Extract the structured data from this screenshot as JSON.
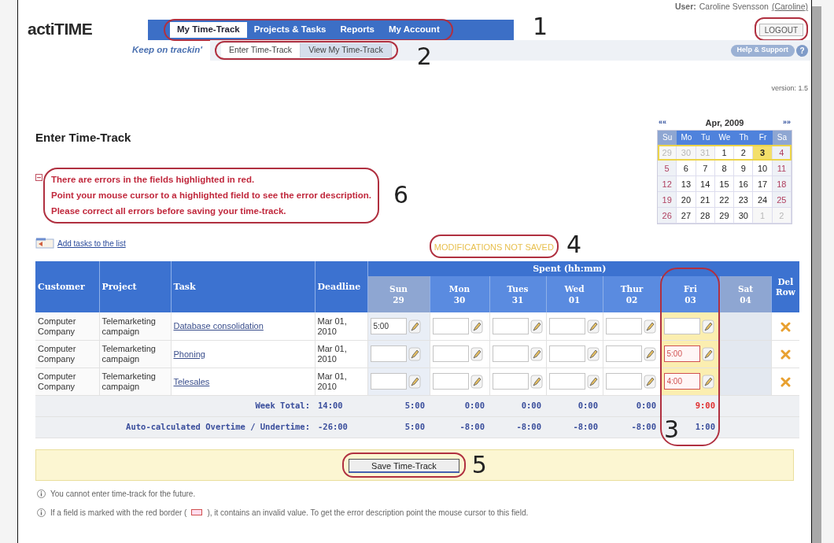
{
  "logo": {
    "name": "actiTIME",
    "slogan": "Keep on trackin'"
  },
  "main_tabs": {
    "callout": "1",
    "items": [
      {
        "label": "My Time-Track",
        "selected": true
      },
      {
        "label": "Projects & Tasks",
        "selected": false
      },
      {
        "label": "Reports",
        "selected": false
      },
      {
        "label": "My Account",
        "selected": false
      }
    ]
  },
  "user": {
    "label": "User:",
    "name": "Caroline Svensson",
    "login": "(Caroline)"
  },
  "logout": {
    "label": "LOGOUT"
  },
  "sub_tabs": {
    "callout": "2",
    "items": [
      {
        "label": "Enter Time-Track",
        "selected": true
      },
      {
        "label": "View My Time-Track",
        "selected": false
      }
    ]
  },
  "help": {
    "label": "Help & Support",
    "icon_text": "?"
  },
  "version": "version: 1.5",
  "title": "Enter Time-Track",
  "errors": {
    "callout": "6",
    "lines": [
      "There are errors in the fields highlighted in red.",
      "Point your mouse cursor to a highlighted field to see the error description.",
      "Please correct all errors before saving your time-track."
    ]
  },
  "add_tasks": "Add tasks to the list",
  "status": {
    "callout": "4",
    "text": "MODIFICATIONS NOT SAVED"
  },
  "calendar": {
    "prev": "««",
    "next": "»»",
    "month": "Apr, 2009",
    "weekdays": [
      "Su",
      "Mo",
      "Tu",
      "We",
      "Th",
      "Fr",
      "Sa"
    ],
    "weeks": [
      {
        "selected": true,
        "days": [
          {
            "d": "29",
            "kind": "other"
          },
          {
            "d": "30",
            "kind": "other"
          },
          {
            "d": "31",
            "kind": "other"
          },
          {
            "d": "1",
            "kind": "day"
          },
          {
            "d": "2",
            "kind": "day"
          },
          {
            "d": "3",
            "kind": "today"
          },
          {
            "d": "4",
            "kind": "weekend"
          }
        ]
      },
      {
        "selected": false,
        "days": [
          {
            "d": "5",
            "kind": "weekend"
          },
          {
            "d": "6",
            "kind": "day"
          },
          {
            "d": "7",
            "kind": "day"
          },
          {
            "d": "8",
            "kind": "day"
          },
          {
            "d": "9",
            "kind": "day"
          },
          {
            "d": "10",
            "kind": "day"
          },
          {
            "d": "11",
            "kind": "weekend"
          }
        ]
      },
      {
        "selected": false,
        "days": [
          {
            "d": "12",
            "kind": "weekend"
          },
          {
            "d": "13",
            "kind": "day"
          },
          {
            "d": "14",
            "kind": "day"
          },
          {
            "d": "15",
            "kind": "day"
          },
          {
            "d": "16",
            "kind": "day"
          },
          {
            "d": "17",
            "kind": "day"
          },
          {
            "d": "18",
            "kind": "weekend"
          }
        ]
      },
      {
        "selected": false,
        "days": [
          {
            "d": "19",
            "kind": "weekend"
          },
          {
            "d": "20",
            "kind": "day"
          },
          {
            "d": "21",
            "kind": "day"
          },
          {
            "d": "22",
            "kind": "day"
          },
          {
            "d": "23",
            "kind": "day"
          },
          {
            "d": "24",
            "kind": "day"
          },
          {
            "d": "25",
            "kind": "weekend"
          }
        ]
      },
      {
        "selected": false,
        "days": [
          {
            "d": "26",
            "kind": "weekend"
          },
          {
            "d": "27",
            "kind": "day"
          },
          {
            "d": "28",
            "kind": "day"
          },
          {
            "d": "29",
            "kind": "day"
          },
          {
            "d": "30",
            "kind": "day"
          },
          {
            "d": "1",
            "kind": "other"
          },
          {
            "d": "2",
            "kind": "other"
          }
        ]
      }
    ]
  },
  "table": {
    "columns": [
      "Customer",
      "Project",
      "Task",
      "Deadline"
    ],
    "spent_label": "Spent (hh:mm)",
    "del_label": "Del Row",
    "callout": "3",
    "days": [
      {
        "name": "Sun",
        "date": "29",
        "kind": "weekend"
      },
      {
        "name": "Mon",
        "date": "30",
        "kind": "workday"
      },
      {
        "name": "Tues",
        "date": "31",
        "kind": "workday"
      },
      {
        "name": "Wed",
        "date": "01",
        "kind": "workday"
      },
      {
        "name": "Thur",
        "date": "02",
        "kind": "workday"
      },
      {
        "name": "Fri",
        "date": "03",
        "kind": "today"
      },
      {
        "name": "Sat",
        "date": "04",
        "kind": "future"
      }
    ],
    "rows": [
      {
        "customer": "Computer Company",
        "project": "Telemarketing campaign",
        "task": "Database consolidation",
        "deadline": "Mar 01, 2010",
        "cells": [
          {
            "value": "5:00",
            "error": false
          },
          {
            "error": false
          },
          {
            "error": false
          },
          {
            "error": false
          },
          {
            "error": false
          },
          {
            "error": false
          }
        ]
      },
      {
        "customer": "Computer Company",
        "project": "Telemarketing campaign",
        "task": "Phoning",
        "deadline": "Mar 01, 2010",
        "cells": [
          {
            "error": false
          },
          {
            "error": false
          },
          {
            "error": false
          },
          {
            "error": false
          },
          {
            "error": false
          },
          {
            "value": "5:00",
            "error": true
          }
        ]
      },
      {
        "customer": "Computer Company",
        "project": "Telemarketing campaign",
        "task": "Telesales",
        "deadline": "Mar 01, 2010",
        "cells": [
          {
            "error": false
          },
          {
            "error": false
          },
          {
            "error": false
          },
          {
            "error": false
          },
          {
            "error": false
          },
          {
            "value": "4:00",
            "error": true
          }
        ]
      }
    ],
    "totals": [
      {
        "label": "Week Total:",
        "total": "14:00",
        "values": [
          {
            "v": "5:00",
            "color": "#3a4e9c"
          },
          {
            "v": "0:00",
            "color": "#3a4e9c"
          },
          {
            "v": "0:00",
            "color": "#3a4e9c"
          },
          {
            "v": "0:00",
            "color": "#3a4e9c"
          },
          {
            "v": "0:00",
            "color": "#3a4e9c"
          },
          {
            "v": "9:00",
            "color": "#e03030"
          }
        ]
      },
      {
        "label": "Auto-calculated Overtime / Undertime:",
        "total": "-26:00",
        "values": [
          {
            "v": "5:00",
            "color": "#3a4e9c"
          },
          {
            "v": "-8:00",
            "color": "#3a4e9c"
          },
          {
            "v": "-8:00",
            "color": "#3a4e9c"
          },
          {
            "v": "-8:00",
            "color": "#3a4e9c"
          },
          {
            "v": "-8:00",
            "color": "#3a4e9c"
          },
          {
            "v": "1:00",
            "color": "#3a4e9c"
          }
        ]
      }
    ]
  },
  "save": {
    "label": "Save Time-Track",
    "callout": "5"
  },
  "notes": [
    {
      "before": "You cannot enter time-track for the future."
    },
    {
      "before": "If a field is marked with the red border (",
      "after": "), it contains an invalid value. To get the error description point the mouse cursor to this field."
    }
  ]
}
